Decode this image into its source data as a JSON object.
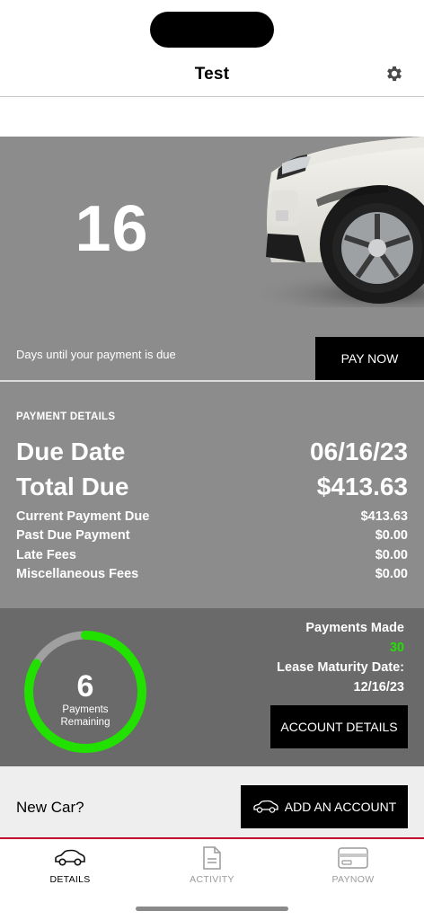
{
  "header": {
    "title": "Test",
    "settings_icon": "gear-icon"
  },
  "hero": {
    "days_until_due": "16",
    "caption": "Days until your payment is due",
    "pay_now_label": "PAY NOW",
    "car_image": "car-image"
  },
  "payment_details": {
    "section_label": "PAYMENT DETAILS",
    "due_date_label": "Due Date",
    "due_date_value": "06/16/23",
    "total_due_label": "Total Due",
    "total_due_value": "$413.63",
    "rows": [
      {
        "label": "Current Payment Due",
        "value": "$413.63"
      },
      {
        "label": "Past Due Payment",
        "value": "$0.00"
      },
      {
        "label": "Late Fees",
        "value": "$0.00"
      },
      {
        "label": "Miscellaneous Fees",
        "value": "$0.00"
      }
    ]
  },
  "payments": {
    "remaining_count": "6",
    "remaining_label_line1": "Payments",
    "remaining_label_line2": "Remaining",
    "progress_fraction": 0.833,
    "made_label": "Payments Made",
    "made_value": "30",
    "maturity_label": "Lease Maturity Date:",
    "maturity_value": "12/16/23",
    "account_details_label": "ACCOUNT DETAILS",
    "colors": {
      "progress": "#22e000",
      "track": "#a0a0a0"
    }
  },
  "new_car": {
    "label": "New Car?",
    "add_account_label": "ADD AN ACCOUNT",
    "icon": "car-icon"
  },
  "tabs": [
    {
      "label": "DETAILS",
      "icon": "car-icon",
      "active": true
    },
    {
      "label": "ACTIVITY",
      "icon": "document-icon",
      "active": false
    },
    {
      "label": "PAYNOW",
      "icon": "credit-card-icon",
      "active": false
    }
  ],
  "colors": {
    "brand_accent": "#c3002f",
    "panel_gray": "#8c8c8c",
    "dark_panel": "#6a6a6a"
  }
}
